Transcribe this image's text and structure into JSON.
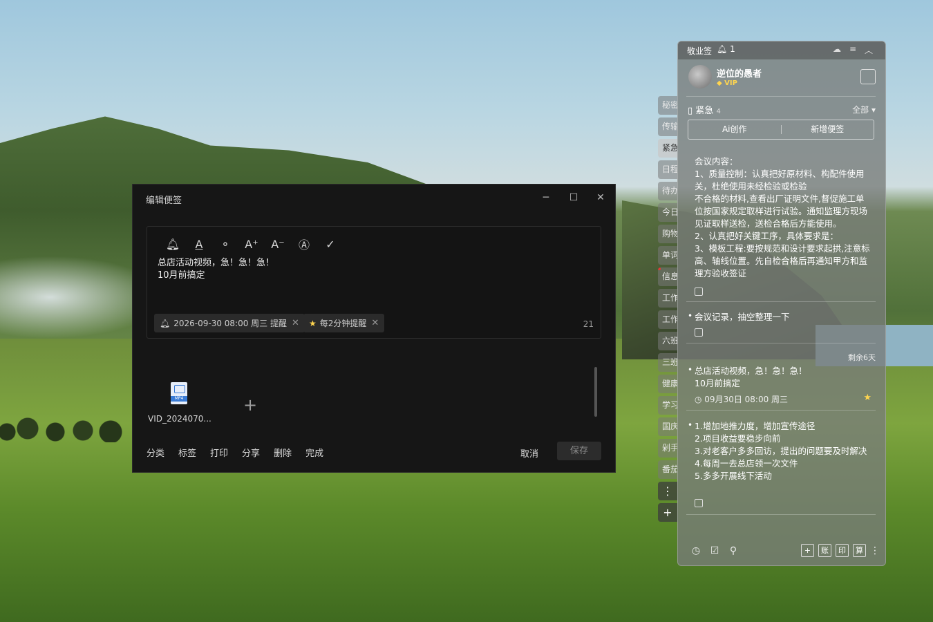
{
  "editor": {
    "title": "编辑便签",
    "toolbar_icons": [
      "bell-icon",
      "underline-icon",
      "search-icon",
      "font-increase-icon",
      "font-decrease-icon",
      "text-style-icon",
      "check-icon"
    ],
    "text_line1": "总店活动视频，急！急！急！",
    "text_line2": "10月前搞定",
    "reminder_chip": "2026-09-30 08:00 周三 提醒",
    "repeat_chip": "每2分钟提醒",
    "char_count": "21",
    "attachment": {
      "filename": "VID_2024070...",
      "type": "MP4"
    },
    "actions": [
      "分类",
      "标签",
      "打印",
      "分享",
      "删除",
      "完成"
    ],
    "cancel": "取消",
    "save": "保存"
  },
  "sidetabs": [
    "秘密",
    "传输",
    "紧急",
    "日程",
    "待办",
    "今日",
    "购物",
    "单词",
    "信息",
    "工作",
    "工作",
    "六班",
    "三班",
    "健康",
    "学习",
    "国庆",
    "剁手",
    "番茄"
  ],
  "panel": {
    "app_name": "敬业签",
    "notif_count": "1",
    "username": "逆位的愚者",
    "vip": "VIP",
    "category": "紧急",
    "category_count": "4",
    "filter": "全部",
    "ai_button": "Ai创作",
    "new_button": "新增便签",
    "notes": [
      {
        "lines": [
          "会议内容：",
          "1、质量控制：认真把好原材料、构配件使用关，杜绝使用未经检验或检验",
          "不合格的材料,查看出厂证明文件,督促施工单位按国家规定取样进行试验。通知监理方现场见证取样送检，送检合格后方能使用。",
          "2、认真把好关键工序，具体要求是：",
          "3、模板工程:要按规范和设计要求起拱,注意标高、轴线位置。先自检合格后再通知甲方和监理方验收签证"
        ]
      },
      {
        "lines": [
          "会议记录，抽空整理一下"
        ]
      },
      {
        "lines": [
          "总店活动视频，急！急！急！",
          "10月前搞定"
        ],
        "remain": "剩余6天",
        "time": "09月30日 08:00 周三"
      },
      {
        "lines": [
          "1.增加地推力度，增加宣传途径",
          "2.项目收益要稳步向前",
          "3.对老客户多多回访，提出的问题要及时解决",
          "4.每周一去总店领一次文件",
          "5.多多开展线下活动"
        ]
      }
    ],
    "bottom_right": [
      "账",
      "印",
      "算"
    ]
  }
}
